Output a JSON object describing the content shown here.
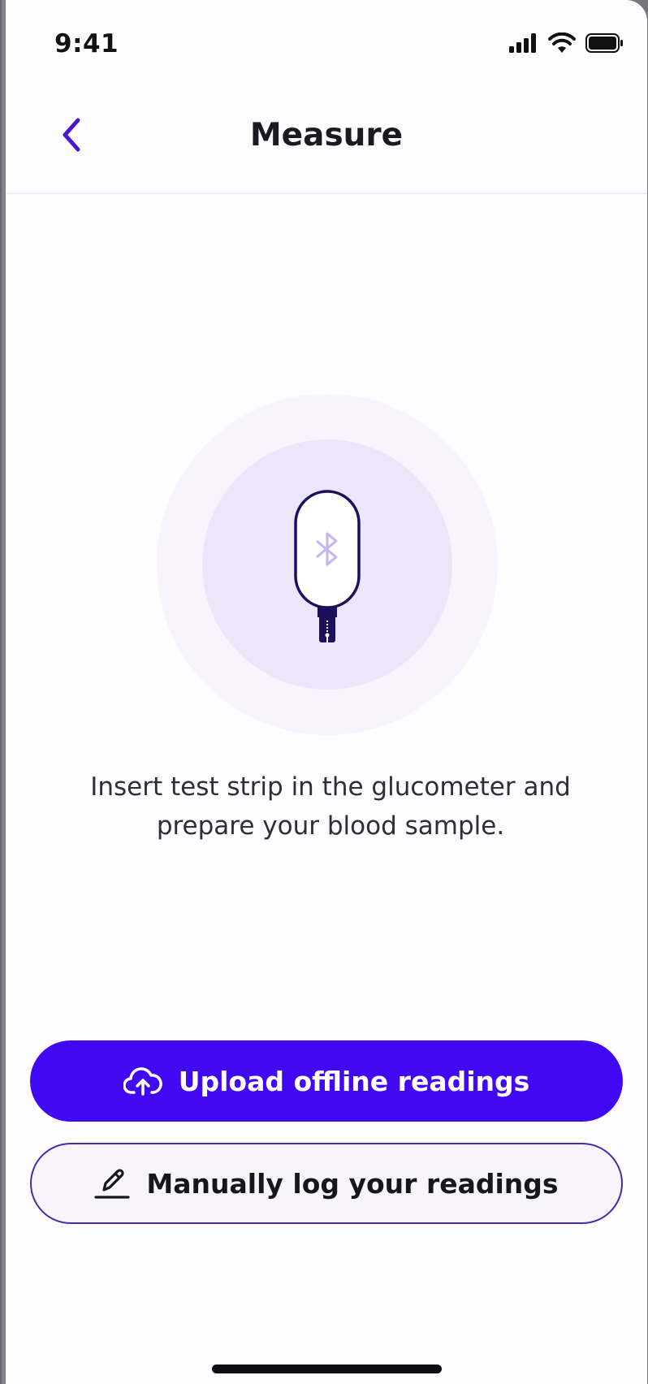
{
  "status_bar": {
    "time": "9:41",
    "icons": [
      "signal-icon",
      "wifi-icon",
      "battery-icon"
    ]
  },
  "nav": {
    "back_icon": "chevron-left-icon",
    "title": "Measure"
  },
  "illustration": {
    "icon": "glucometer-bluetooth-icon"
  },
  "instruction": {
    "line1": "Insert test strip in the glucometer and",
    "line2": "prepare your blood sample."
  },
  "actions": {
    "upload": {
      "label": "Upload offline readings",
      "icon": "cloud-upload-icon"
    },
    "manual": {
      "label": "Manually log your readings",
      "icon": "pencil-icon"
    }
  },
  "colors": {
    "accent": "#4108f4",
    "accent_dark": "#4a2aa8",
    "back_chevron": "#4a17d1",
    "circle_outer": "#f8f4fe",
    "circle_inner": "#ede6fb"
  }
}
